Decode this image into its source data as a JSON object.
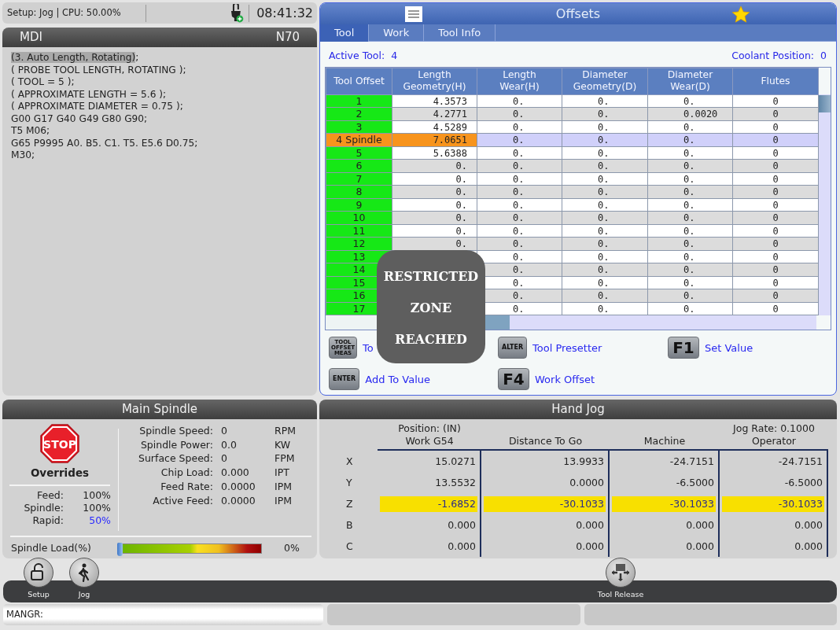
{
  "top_status": {
    "text": "Setup: Jog | CPU: 50.00%",
    "time": "08:41:32"
  },
  "mdi": {
    "title": "MDI",
    "block": "N70",
    "lines": [
      {
        "text": "(3. Auto Length, Rotating)",
        "tail": ";",
        "highlighted": true
      },
      {
        "text": "( PROBE TOOL LENGTH, ROTATING );",
        "highlighted": false
      },
      {
        "text": "( TOOL = 5 );",
        "highlighted": false
      },
      {
        "text": "( APPROXIMATE LENGTH = 5.6 );",
        "highlighted": false
      },
      {
        "text": "( APPROXIMATE DIAMETER = 0.75 );",
        "highlighted": false
      },
      {
        "text": "G00 G17 G40 G49 G80 G90;",
        "highlighted": false
      },
      {
        "text": "T5 M06;",
        "highlighted": false
      },
      {
        "text": "G65 P9995 A0. B5. C1. T5. E5.6 D0.75;",
        "highlighted": false
      },
      {
        "text": "M30;",
        "highlighted": false
      }
    ]
  },
  "offsets": {
    "title": "Offsets",
    "tabs": [
      {
        "label": "Tool",
        "selected": true
      },
      {
        "label": "Work",
        "selected": false
      },
      {
        "label": "Tool Info",
        "selected": false
      }
    ],
    "active_tool": {
      "label": "Active Tool:",
      "value": "4"
    },
    "coolant_position": {
      "label": "Coolant Position:",
      "value": "0"
    },
    "table": {
      "columns": [
        "Tool Offset",
        "Length Geometry(H)",
        "Length Wear(H)",
        "Diameter Geometry(D)",
        "Diameter Wear(D)",
        "Flutes"
      ],
      "rows": [
        {
          "cells": [
            "1",
            "4.3573",
            "0.",
            "0.",
            "0.",
            "0"
          ],
          "selected": false
        },
        {
          "cells": [
            "2",
            "4.2771",
            "0.",
            "0.",
            "0.0020",
            "0"
          ],
          "selected": false
        },
        {
          "cells": [
            "3",
            "4.5289",
            "0.",
            "0.",
            "0.",
            "0"
          ],
          "selected": false
        },
        {
          "cells": [
            "4 Spindle",
            "7.0651",
            "0.",
            "0.",
            "0.",
            "0"
          ],
          "selected": true
        },
        {
          "cells": [
            "5",
            "5.6388",
            "0.",
            "0.",
            "0.",
            "0"
          ],
          "selected": false
        },
        {
          "cells": [
            "6",
            "0.",
            "0.",
            "0.",
            "0.",
            "0"
          ],
          "selected": false
        },
        {
          "cells": [
            "7",
            "0.",
            "0.",
            "0.",
            "0.",
            "0"
          ],
          "selected": false
        },
        {
          "cells": [
            "8",
            "0.",
            "0.",
            "0.",
            "0.",
            "0"
          ],
          "selected": false
        },
        {
          "cells": [
            "9",
            "0.",
            "0.",
            "0.",
            "0.",
            "0"
          ],
          "selected": false
        },
        {
          "cells": [
            "10",
            "0.",
            "0.",
            "0.",
            "0.",
            "0"
          ],
          "selected": false
        },
        {
          "cells": [
            "11",
            "0.",
            "0.",
            "0.",
            "0.",
            "0"
          ],
          "selected": false
        },
        {
          "cells": [
            "12",
            "0.",
            "0.",
            "0.",
            "0.",
            "0"
          ],
          "selected": false
        },
        {
          "cells": [
            "13",
            null,
            "0.",
            "0.",
            "0.",
            "0"
          ],
          "selected": false
        },
        {
          "cells": [
            "14",
            null,
            "0.",
            "0.",
            "0.",
            "0"
          ],
          "selected": false
        },
        {
          "cells": [
            "15",
            null,
            "0.",
            "0.",
            "0.",
            "0"
          ],
          "selected": false
        },
        {
          "cells": [
            "16",
            null,
            "0.",
            "0.",
            "0.",
            "0"
          ],
          "selected": false
        },
        {
          "cells": [
            "17",
            null,
            "0.",
            "0.",
            "0.",
            "0"
          ],
          "selected": false
        }
      ]
    },
    "keys": [
      {
        "kind": "stacked",
        "key": "TOOL OFFSET MEAS",
        "label": "To"
      },
      {
        "kind": "word",
        "key": "ALTER",
        "label": "Tool Presetter"
      },
      {
        "kind": "function",
        "key": "F1",
        "label": "Set Value"
      },
      {
        "kind": "word",
        "key": "ENTER",
        "label": "Add To Value"
      },
      {
        "kind": "function",
        "key": "F4",
        "label": "Work Offset"
      }
    ],
    "alert": {
      "lines": [
        "RESTRICTED",
        "ZONE",
        "REACHED"
      ]
    }
  },
  "main_spindle": {
    "title": "Main Spindle",
    "stop_sign": "STOP",
    "overrides_title": "Overrides",
    "overrides": [
      {
        "label": "Feed:",
        "value": "100%",
        "highlighted": false
      },
      {
        "label": "Spindle:",
        "value": "100%",
        "highlighted": false
      },
      {
        "label": "Rapid:",
        "value": "50%",
        "highlighted": true
      }
    ],
    "readings": [
      {
        "label": "Spindle Speed:",
        "value": "0",
        "unit": "RPM"
      },
      {
        "label": "Spindle Power:",
        "value": "0.0",
        "unit": "KW"
      },
      {
        "label": "Surface Speed:",
        "value": "0",
        "unit": "FPM"
      },
      {
        "label": "Chip Load:",
        "value": "0.000",
        "unit": "IPT"
      },
      {
        "label": "Feed Rate:",
        "value": "0.0000",
        "unit": "IPM"
      },
      {
        "label": "Active Feed:",
        "value": "0.0000",
        "unit": "IPM"
      }
    ],
    "load": {
      "label": "Spindle Load(%)",
      "level": 0,
      "reading": "0%"
    }
  },
  "hand_jog": {
    "title": "Hand Jog",
    "position_label": "Position: (IN)",
    "jog_rate": "Jog Rate: 0.1000",
    "columns": [
      "Work G54",
      "Distance To Go",
      "Machine",
      "Operator"
    ],
    "rows": [
      {
        "axis": "X",
        "values": [
          "15.0271",
          "13.9933",
          "-24.7151",
          "-24.7151"
        ],
        "selected": false
      },
      {
        "axis": "Y",
        "values": [
          "13.5532",
          "0.0000",
          "-6.5000",
          "-6.5000"
        ],
        "selected": false
      },
      {
        "axis": "Z",
        "values": [
          "-1.6852",
          "-30.1033",
          "-30.1033",
          "-30.1033"
        ],
        "selected": true
      },
      {
        "axis": "B",
        "values": [
          "0.000",
          "0.000",
          "0.000",
          "0.000"
        ],
        "selected": false
      },
      {
        "axis": "C",
        "values": [
          "0.000",
          "0.000",
          "0.000",
          "0.000"
        ],
        "selected": false
      }
    ]
  },
  "toolbar": {
    "buttons": [
      {
        "kind": "lock",
        "label": "Setup"
      },
      {
        "kind": "person",
        "label": "Jog"
      },
      {
        "kind": "release",
        "label": "Tool Release"
      }
    ]
  },
  "command_line": {
    "text": "MANGR:"
  }
}
